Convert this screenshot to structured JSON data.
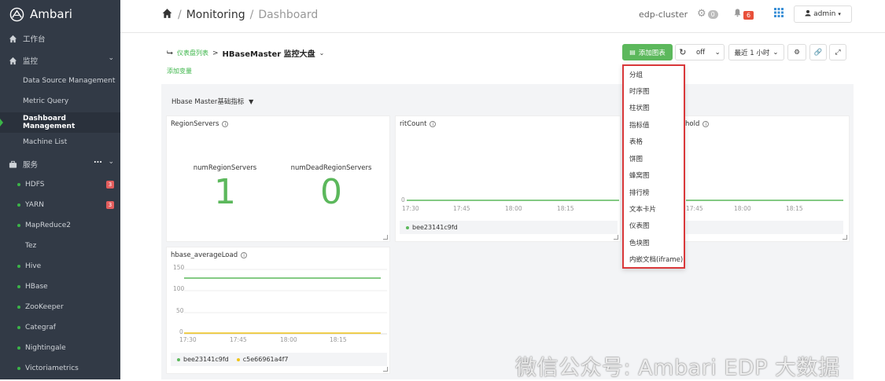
{
  "app": {
    "name": "Ambari"
  },
  "sidebar": {
    "workbench": "工作台",
    "monitor": "监控",
    "monitor_items": [
      "Data Source Management",
      "Metric Query",
      "Dashboard Management",
      "Machine List"
    ],
    "services_label": "服务",
    "services_more": "...",
    "services": [
      {
        "name": "HDFS",
        "badge": "3"
      },
      {
        "name": "YARN",
        "badge": "3"
      },
      {
        "name": "MapReduce2",
        "badge": ""
      },
      {
        "name": "Tez",
        "badge": ""
      },
      {
        "name": "Hive",
        "badge": ""
      },
      {
        "name": "HBase",
        "badge": ""
      },
      {
        "name": "ZooKeeper",
        "badge": ""
      },
      {
        "name": "Categraf",
        "badge": ""
      },
      {
        "name": "Nightingale",
        "badge": ""
      },
      {
        "name": "Victoriametrics",
        "badge": ""
      }
    ]
  },
  "topbar": {
    "breadcrumb_monitoring": "Monitoring",
    "breadcrumb_dashboard": "Dashboard",
    "cluster": "edp-cluster",
    "ops_count": "0",
    "alert_count": "6",
    "user": "admin",
    "colors": {
      "alert": "#e8503a",
      "ops": "#bbbbbb"
    }
  },
  "dashboard": {
    "back_link": "仪表盘列表",
    "title": "HBaseMaster 监控大盘",
    "add_variable": "添加变量",
    "add_chart": "添加图表",
    "refresh_off": "off",
    "time_range": "最近 1 小时",
    "group_header": "Hbase Master基础指标"
  },
  "panels": {
    "region_servers": {
      "title": "RegionServers",
      "stats": [
        {
          "label": "numRegionServers",
          "value": "1"
        },
        {
          "label": "numDeadRegionServers",
          "value": "0"
        }
      ]
    },
    "rit_count": {
      "title": "ritCount",
      "y_tick": "0",
      "x_ticks": [
        "17:30",
        "17:45",
        "18:00",
        "18:15"
      ],
      "legend": [
        "bee23141c9fd"
      ]
    },
    "threshold": {
      "title": "hold",
      "x_ticks": [
        "17:45",
        "18:00",
        "18:15"
      ]
    },
    "average_load": {
      "title": "hbase_averageLoad",
      "y_ticks": [
        "150",
        "100",
        "50",
        "0"
      ],
      "x_ticks": [
        "17:30",
        "17:45",
        "18:00",
        "18:15"
      ],
      "legend": [
        "bee23141c9fd",
        "c5e66961a4f7"
      ],
      "series_colors": [
        "#5cb85c",
        "#f0c419"
      ]
    }
  },
  "chart_menu": {
    "items": [
      "分组",
      "时序图",
      "柱状图",
      "指标值",
      "表格",
      "饼图",
      "蜂窝图",
      "排行榜",
      "文本卡片",
      "仪表图",
      "色块图",
      "内嵌文档(iframe)"
    ]
  },
  "watermark": "微信公众号: Ambari EDP 大数据"
}
